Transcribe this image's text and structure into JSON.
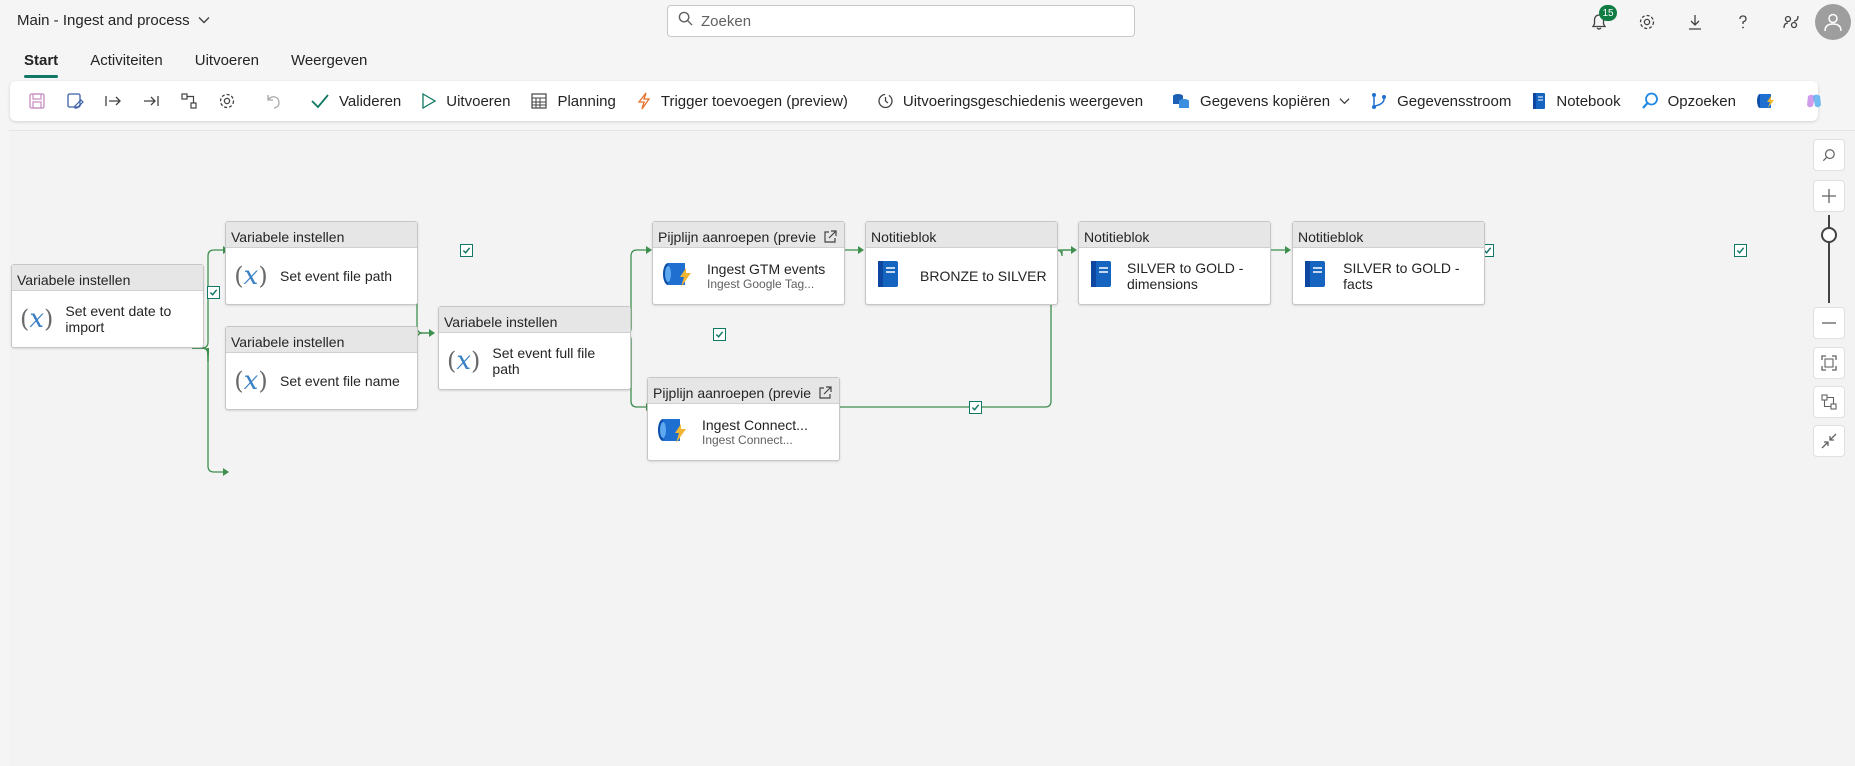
{
  "header": {
    "title": "Main - Ingest and process",
    "search_placeholder": "Zoeken",
    "notification_count": "15"
  },
  "tabs": [
    {
      "label": "Start",
      "active": true
    },
    {
      "label": "Activiteiten",
      "active": false
    },
    {
      "label": "Uitvoeren",
      "active": false
    },
    {
      "label": "Weergeven",
      "active": false
    }
  ],
  "toolbar": {
    "validate": "Valideren",
    "run": "Uitvoeren",
    "schedule": "Planning",
    "trigger": "Trigger toevoegen (preview)",
    "history": "Uitvoeringsgeschiedenis weergeven",
    "copy_data": "Gegevens kopiëren",
    "dataflow": "Gegevensstroom",
    "notebook": "Notebook",
    "lookup": "Opzoeken"
  },
  "nodes": [
    {
      "header": "Variabele instellen",
      "label": "Set event date to import",
      "icon": "variable-icon"
    },
    {
      "header": "Variabele instellen",
      "label": "Set event file path",
      "icon": "variable-icon"
    },
    {
      "header": "Variabele instellen",
      "label": "Set event file name",
      "icon": "variable-icon"
    },
    {
      "header": "Variabele instellen",
      "label": "Set event full file path",
      "icon": "variable-icon"
    },
    {
      "header": "Pijplijn aanroepen (previe",
      "label": "Ingest GTM events",
      "sub": "Ingest Google Tag...",
      "icon": "pipeline-icon"
    },
    {
      "header": "Pijplijn aanroepen (previe",
      "label": "Ingest Connect...",
      "sub": "Ingest Connect...",
      "icon": "pipeline-icon"
    },
    {
      "header": "Notitieblok",
      "label": "BRONZE to SILVER",
      "icon": "notebook-icon"
    },
    {
      "header": "Notitieblok",
      "label": "SILVER to GOLD - dimensions",
      "icon": "notebook-icon"
    },
    {
      "header": "Notitieblok",
      "label": "SILVER to GOLD - facts",
      "icon": "notebook-icon"
    }
  ],
  "colors": {
    "accent": "#117865",
    "edge": "#3f8f4f",
    "variable": "#3b82c4",
    "notebook": "#1565c0"
  }
}
